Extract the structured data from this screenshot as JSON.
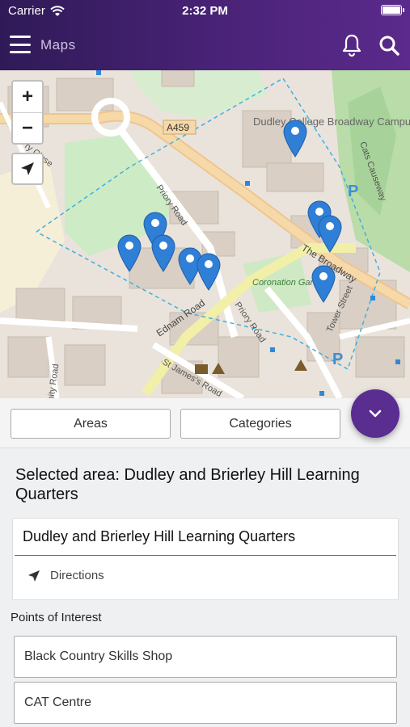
{
  "status_bar": {
    "carrier": "Carrier",
    "time": "2:32 PM"
  },
  "header": {
    "title": "Maps",
    "icons": [
      "menu-icon",
      "bell-icon",
      "search-icon"
    ]
  },
  "map": {
    "zoom_in": "+",
    "zoom_out": "−",
    "labels": {
      "road_a459": "A459",
      "college": "Dudley College Broadway Campus",
      "priory_road": "Priory Road",
      "priory_road_2": "Priory Road",
      "the_broadway": "The Broadway",
      "coronation": "Coronation Gardens",
      "ednam_road": "Ednam Road",
      "st_james": "St James's Road",
      "tower_street": "Tower Street",
      "cats_causeway": "Cats Causeway",
      "parking_1": "P",
      "parking_2": "P",
      "ry_close": "ry Close",
      "unity_road": "nity Road"
    },
    "pin_count": 9
  },
  "controls": {
    "areas": "Areas",
    "categories": "Categories"
  },
  "selected_area": {
    "text": "Selected area: Dudley and Brierley Hill Learning Quarters",
    "card_title": "Dudley and Brierley Hill Learning Quarters",
    "directions": "Directions"
  },
  "poi": {
    "label": "Points of Interest",
    "items": [
      "Black Country Skills Shop",
      "CAT Centre"
    ]
  },
  "colors": {
    "header": "#4a2378",
    "fab": "#5a2d91",
    "pin": "#2f7fd6"
  }
}
